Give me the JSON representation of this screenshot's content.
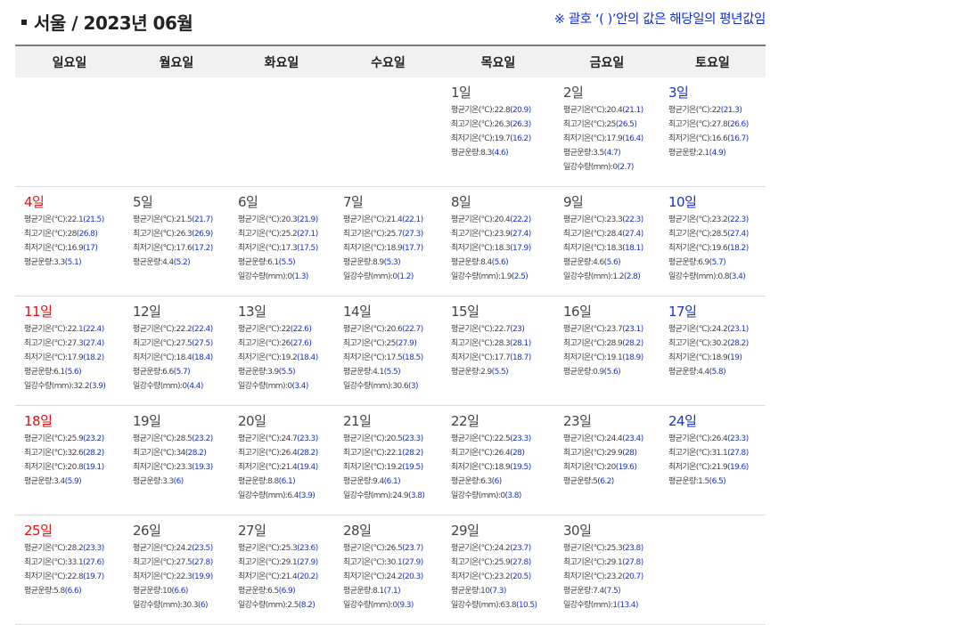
{
  "header": {
    "title": "서울 / 2023년 06월",
    "note": "※ 괄호 ‘( )’안의 값은 해당일의 평년값임"
  },
  "weekdays": [
    "일요일",
    "월요일",
    "화요일",
    "수요일",
    "목요일",
    "금요일",
    "토요일"
  ],
  "colors": {
    "sunday": "#e01111",
    "saturday": "#1a33c8",
    "normal_value": "#1a33c8",
    "accent_note": "#0f2fd3"
  },
  "labels": {
    "avg": "평균기온(℃):",
    "max": "최고기온(℃):",
    "min": "최저기온(℃):",
    "cloud": "평균운량:",
    "rain": "일강수량(mm):"
  },
  "weeks": [
    [
      null,
      null,
      null,
      null,
      {
        "day": "1일",
        "avg": [
          "22.8",
          "20.9"
        ],
        "max": [
          "26.3",
          "26.3"
        ],
        "min": [
          "19.7",
          "16.2"
        ],
        "cloud": [
          "8.3",
          "4.6"
        ]
      },
      {
        "day": "2일",
        "avg": [
          "20.4",
          "21.1"
        ],
        "max": [
          "25",
          "26.5"
        ],
        "min": [
          "17.9",
          "16.4"
        ],
        "cloud": [
          "3.5",
          "4.7"
        ],
        "rain": [
          "0",
          "2.7"
        ]
      },
      {
        "day": "3일",
        "avg": [
          "22",
          "21.3"
        ],
        "max": [
          "27.8",
          "26.6"
        ],
        "min": [
          "16.6",
          "16.7"
        ],
        "cloud": [
          "2.1",
          "4.9"
        ]
      }
    ],
    [
      {
        "day": "4일",
        "avg": [
          "22.1",
          "21.5"
        ],
        "max": [
          "28",
          "26.8"
        ],
        "min": [
          "16.9",
          "17"
        ],
        "cloud": [
          "3.3",
          "5.1"
        ]
      },
      {
        "day": "5일",
        "avg": [
          "21.5",
          "21.7"
        ],
        "max": [
          "26.3",
          "26.9"
        ],
        "min": [
          "17.6",
          "17.2"
        ],
        "cloud": [
          "4.4",
          "5.2"
        ]
      },
      {
        "day": "6일",
        "avg": [
          "20.3",
          "21.9"
        ],
        "max": [
          "25.2",
          "27.1"
        ],
        "min": [
          "17.3",
          "17.5"
        ],
        "cloud": [
          "6.1",
          "5.5"
        ],
        "rain": [
          "0",
          "1.3"
        ]
      },
      {
        "day": "7일",
        "avg": [
          "21.4",
          "22.1"
        ],
        "max": [
          "25.7",
          "27.3"
        ],
        "min": [
          "18.9",
          "17.7"
        ],
        "cloud": [
          "8.9",
          "5.3"
        ],
        "rain": [
          "0",
          "1.2"
        ]
      },
      {
        "day": "8일",
        "avg": [
          "20.4",
          "22.2"
        ],
        "max": [
          "23.9",
          "27.4"
        ],
        "min": [
          "18.3",
          "17.9"
        ],
        "cloud": [
          "8.4",
          "5.6"
        ],
        "rain": [
          "1.9",
          "2.5"
        ]
      },
      {
        "day": "9일",
        "avg": [
          "23.3",
          "22.3"
        ],
        "max": [
          "28.4",
          "27.4"
        ],
        "min": [
          "18.3",
          "18.1"
        ],
        "cloud": [
          "4.6",
          "5.6"
        ],
        "rain": [
          "1.2",
          "2.8"
        ]
      },
      {
        "day": "10일",
        "avg": [
          "23.2",
          "22.3"
        ],
        "max": [
          "28.5",
          "27.4"
        ],
        "min": [
          "19.6",
          "18.2"
        ],
        "cloud": [
          "6.9",
          "5.7"
        ],
        "rain": [
          "0.8",
          "3.4"
        ]
      }
    ],
    [
      {
        "day": "11일",
        "avg": [
          "22.1",
          "22.4"
        ],
        "max": [
          "27.3",
          "27.4"
        ],
        "min": [
          "17.9",
          "18.2"
        ],
        "cloud": [
          "6.1",
          "5.6"
        ],
        "rain": [
          "32.2",
          "3.9"
        ]
      },
      {
        "day": "12일",
        "avg": [
          "22.2",
          "22.4"
        ],
        "max": [
          "27.5",
          "27.5"
        ],
        "min": [
          "18.4",
          "18.4"
        ],
        "cloud": [
          "6.6",
          "5.7"
        ],
        "rain": [
          "0",
          "4.4"
        ]
      },
      {
        "day": "13일",
        "avg": [
          "22",
          "22.6"
        ],
        "max": [
          "26",
          "27.6"
        ],
        "min": [
          "19.2",
          "18.4"
        ],
        "cloud": [
          "3.9",
          "5.5"
        ],
        "rain": [
          "0",
          "3.4"
        ]
      },
      {
        "day": "14일",
        "avg": [
          "20.6",
          "22.7"
        ],
        "max": [
          "25",
          "27.9"
        ],
        "min": [
          "17.5",
          "18.5"
        ],
        "cloud": [
          "4.1",
          "5.5"
        ],
        "rain": [
          "30.6",
          "3"
        ]
      },
      {
        "day": "15일",
        "avg": [
          "22.7",
          "23"
        ],
        "max": [
          "28.3",
          "28.1"
        ],
        "min": [
          "17.7",
          "18.7"
        ],
        "cloud": [
          "2.9",
          "5.5"
        ]
      },
      {
        "day": "16일",
        "avg": [
          "23.7",
          "23.1"
        ],
        "max": [
          "28.9",
          "28.2"
        ],
        "min": [
          "19.1",
          "18.9"
        ],
        "cloud": [
          "0.9",
          "5.6"
        ]
      },
      {
        "day": "17일",
        "avg": [
          "24.2",
          "23.1"
        ],
        "max": [
          "30.2",
          "28.2"
        ],
        "min": [
          "18.9",
          "19"
        ],
        "cloud": [
          "4.4",
          "5.8"
        ]
      }
    ],
    [
      {
        "day": "18일",
        "avg": [
          "25.9",
          "23.2"
        ],
        "max": [
          "32.6",
          "28.2"
        ],
        "min": [
          "20.8",
          "19.1"
        ],
        "cloud": [
          "3.4",
          "5.9"
        ]
      },
      {
        "day": "19일",
        "avg": [
          "28.5",
          "23.2"
        ],
        "max": [
          "34",
          "28.2"
        ],
        "min": [
          "23.3",
          "19.3"
        ],
        "cloud": [
          "3.3",
          "6"
        ]
      },
      {
        "day": "20일",
        "avg": [
          "24.7",
          "23.3"
        ],
        "max": [
          "26.4",
          "28.2"
        ],
        "min": [
          "21.4",
          "19.4"
        ],
        "cloud": [
          "8.8",
          "6.1"
        ],
        "rain": [
          "6.4",
          "3.9"
        ]
      },
      {
        "day": "21일",
        "avg": [
          "20.5",
          "23.3"
        ],
        "max": [
          "22.1",
          "28.2"
        ],
        "min": [
          "19.2",
          "19.5"
        ],
        "cloud": [
          "9.4",
          "6.1"
        ],
        "rain": [
          "24.9",
          "3.8"
        ]
      },
      {
        "day": "22일",
        "avg": [
          "22.5",
          "23.3"
        ],
        "max": [
          "26.4",
          "28"
        ],
        "min": [
          "18.9",
          "19.5"
        ],
        "cloud": [
          "6.3",
          "6"
        ],
        "rain": [
          "0",
          "3.8"
        ]
      },
      {
        "day": "23일",
        "avg": [
          "24.4",
          "23.4"
        ],
        "max": [
          "29.9",
          "28"
        ],
        "min": [
          "20",
          "19.6"
        ],
        "cloud": [
          "5",
          "6.2"
        ]
      },
      {
        "day": "24일",
        "avg": [
          "26.4",
          "23.3"
        ],
        "max": [
          "31.1",
          "27.8"
        ],
        "min": [
          "21.9",
          "19.6"
        ],
        "cloud": [
          "1.5",
          "6.5"
        ]
      }
    ],
    [
      {
        "day": "25일",
        "avg": [
          "28.2",
          "23.3"
        ],
        "max": [
          "33.1",
          "27.6"
        ],
        "min": [
          "22.8",
          "19.7"
        ],
        "cloud": [
          "5.8",
          "6.6"
        ]
      },
      {
        "day": "26일",
        "avg": [
          "24.2",
          "23.5"
        ],
        "max": [
          "27.5",
          "27.8"
        ],
        "min": [
          "22.3",
          "19.9"
        ],
        "cloud": [
          "10",
          "6.6"
        ],
        "rain": [
          "30.3",
          "6"
        ]
      },
      {
        "day": "27일",
        "avg": [
          "25.3",
          "23.6"
        ],
        "max": [
          "29.1",
          "27.9"
        ],
        "min": [
          "21.4",
          "20.2"
        ],
        "cloud": [
          "6.5",
          "6.9"
        ],
        "rain": [
          "2.5",
          "8.2"
        ]
      },
      {
        "day": "28일",
        "avg": [
          "26.5",
          "23.7"
        ],
        "max": [
          "30.1",
          "27.9"
        ],
        "min": [
          "24.2",
          "20.3"
        ],
        "cloud": [
          "8.1",
          "7.1"
        ],
        "rain": [
          "0",
          "9.3"
        ]
      },
      {
        "day": "29일",
        "avg": [
          "24.2",
          "23.7"
        ],
        "max": [
          "25.9",
          "27.8"
        ],
        "min": [
          "23.2",
          "20.5"
        ],
        "cloud": [
          "10",
          "7.3"
        ],
        "rain": [
          "63.8",
          "10.5"
        ]
      },
      {
        "day": "30일",
        "avg": [
          "25.3",
          "23.8"
        ],
        "max": [
          "29.1",
          "27.8"
        ],
        "min": [
          "23.2",
          "20.7"
        ],
        "cloud": [
          "7.4",
          "7.5"
        ],
        "rain": [
          "1",
          "13.4"
        ]
      },
      null
    ]
  ]
}
